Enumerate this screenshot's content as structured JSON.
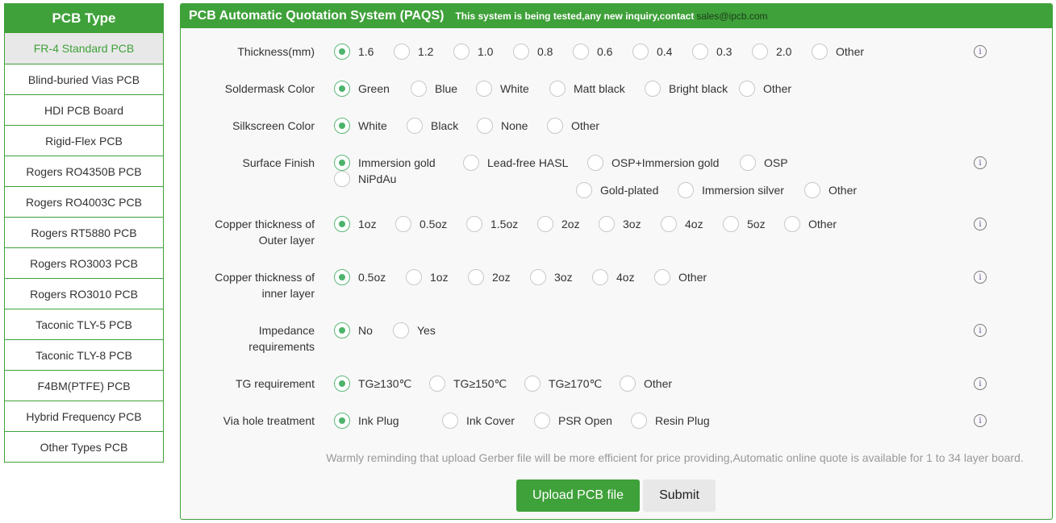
{
  "sidebar": {
    "title": "PCB Type",
    "items": [
      {
        "label": "FR-4 Standard PCB",
        "active": true
      },
      {
        "label": "Blind-buried Vias PCB"
      },
      {
        "label": "HDI PCB Board"
      },
      {
        "label": "Rigid-Flex PCB"
      },
      {
        "label": "Rogers RO4350B PCB"
      },
      {
        "label": "Rogers RO4003C PCB"
      },
      {
        "label": "Rogers RT5880 PCB"
      },
      {
        "label": "Rogers RO3003 PCB"
      },
      {
        "label": "Rogers RO3010 PCB"
      },
      {
        "label": "Taconic TLY-5 PCB"
      },
      {
        "label": "Taconic TLY-8 PCB"
      },
      {
        "label": "F4BM(PTFE) PCB"
      },
      {
        "label": "Hybrid Frequency PCB"
      },
      {
        "label": "Other Types PCB"
      }
    ]
  },
  "header": {
    "title": "PCB Automatic Quotation System (PAQS)",
    "note": "This system is being tested,any new inquiry,contact",
    "email": "sales@ipcb.com"
  },
  "fields": [
    {
      "label": "Thickness(mm)",
      "options": [
        "1.6",
        "1.2",
        "1.0",
        "0.8",
        "0.6",
        "0.4",
        "0.3",
        "2.0",
        "Other"
      ],
      "selected": "1.6",
      "info": true
    },
    {
      "label": "Soldermask Color",
      "options": [
        "Green",
        "Blue",
        "White",
        "Matt black",
        "Bright black",
        "Other"
      ],
      "selected": "Green",
      "info": false
    },
    {
      "label": "Silkscreen Color",
      "options": [
        "White",
        "Black",
        "None",
        "Other"
      ],
      "selected": "White",
      "info": false
    },
    {
      "label": "Surface Finish",
      "options": [
        "Immersion gold",
        "Lead-free HASL",
        "OSP+Immersion gold",
        "OSP",
        "NiPdAu",
        "Gold-plated",
        "Immersion silver",
        "Other"
      ],
      "selected": "Immersion gold",
      "info": true
    },
    {
      "label": "Copper thickness of Outer layer",
      "options": [
        "1oz",
        "0.5oz",
        "1.5oz",
        "2oz",
        "3oz",
        "4oz",
        "5oz",
        "Other"
      ],
      "selected": "1oz",
      "info": true
    },
    {
      "label": "Copper thickness of inner layer",
      "options": [
        "0.5oz",
        "1oz",
        "2oz",
        "3oz",
        "4oz",
        "Other"
      ],
      "selected": "0.5oz",
      "info": true
    },
    {
      "label": "Impedance requirements",
      "options": [
        "No",
        "Yes"
      ],
      "selected": "No",
      "info": true
    },
    {
      "label": "TG requirement",
      "options": [
        "TG≥130℃",
        "TG≥150℃",
        "TG≥170℃",
        "Other"
      ],
      "selected": "TG≥130℃",
      "info": true
    },
    {
      "label": "Via hole treatment",
      "options": [
        "Ink Plug",
        "Ink Cover",
        "PSR Open",
        "Resin Plug"
      ],
      "selected": "Ink Plug",
      "info": true
    }
  ],
  "info_icon": "i",
  "reminder": "Warmly reminding that upload Gerber file will be more efficient for price providing,Automatic online quote is available for 1 to 34 layer board.",
  "buttons": {
    "upload": "Upload PCB file",
    "submit": "Submit"
  }
}
